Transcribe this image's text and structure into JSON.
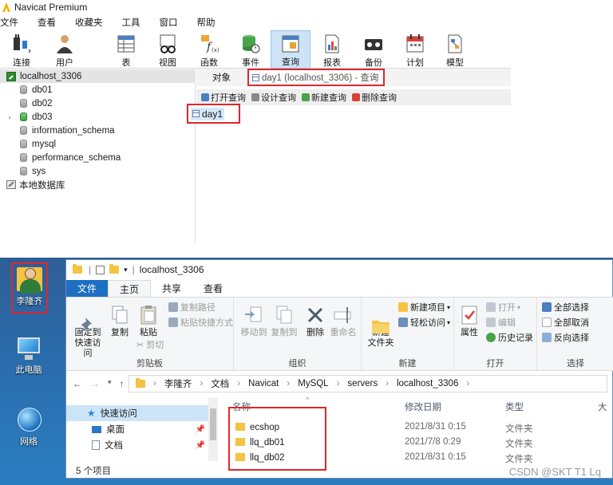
{
  "navicat": {
    "app_title": "Navicat Premium",
    "menu": [
      "文件",
      "查看",
      "收藏夹",
      "工具",
      "窗口",
      "帮助"
    ],
    "toolbar": [
      {
        "label": "连接",
        "icon": "plug-icon"
      },
      {
        "label": "用户",
        "icon": "user-icon"
      },
      {
        "label": "表",
        "icon": "table-icon"
      },
      {
        "label": "视图",
        "icon": "view-icon"
      },
      {
        "label": "函数",
        "icon": "function-icon"
      },
      {
        "label": "事件",
        "icon": "event-icon"
      },
      {
        "label": "查询",
        "icon": "query-icon",
        "active": true
      },
      {
        "label": "报表",
        "icon": "report-icon"
      },
      {
        "label": "备份",
        "icon": "backup-icon"
      },
      {
        "label": "计划",
        "icon": "schedule-icon"
      },
      {
        "label": "模型",
        "icon": "model-icon"
      }
    ],
    "tree": {
      "connection": "localhost_3306",
      "databases": [
        "db01",
        "db02",
        "db03",
        "information_schema",
        "mysql",
        "performance_schema",
        "sys"
      ],
      "local": "本地数据库"
    },
    "objects_tab": "对象",
    "query_tab": "day1 (localhost_3306) - 查询",
    "query_actions": [
      "打开查询",
      "设计查询",
      "新建查询",
      "删除查询"
    ],
    "query_item": "day1"
  },
  "desktop": {
    "icons": [
      {
        "label": "李隆齐"
      },
      {
        "label": "此电脑"
      },
      {
        "label": "网络"
      }
    ]
  },
  "explorer": {
    "title": "localhost_3306",
    "tabs": [
      "文件",
      "主页",
      "共享",
      "查看"
    ],
    "ribbon": {
      "clipboard": {
        "pin": "固定到\n快速访问",
        "copy": "复制",
        "paste": "粘贴",
        "copy_path": "复制路径",
        "paste_shortcut": "粘贴快捷方式",
        "cut": "剪切",
        "group": "剪贴板"
      },
      "organize": {
        "move_to": "移动到",
        "copy_to": "复制到",
        "delete": "删除",
        "rename": "重命名",
        "group": "组织"
      },
      "new": {
        "new_folder": "新建\n文件夹",
        "new_item": "新建项目",
        "easy_access": "轻松访问",
        "group": "新建"
      },
      "open": {
        "properties": "属性",
        "open": "打开",
        "edit": "编辑",
        "history": "历史记录",
        "group": "打开"
      },
      "select": {
        "select_all": "全部选择",
        "select_none": "全部取消",
        "invert": "反向选择",
        "group": "选择"
      }
    },
    "breadcrumb": [
      "李隆齐",
      "文档",
      "Navicat",
      "MySQL",
      "servers",
      "localhost_3306"
    ],
    "nav": [
      {
        "label": "快速访问"
      },
      {
        "label": "桌面"
      },
      {
        "label": "文档"
      }
    ],
    "columns": [
      "名称",
      "修改日期",
      "类型",
      "大"
    ],
    "files": [
      {
        "name": "ecshop",
        "date": "2021/8/31 0:15",
        "type": "文件夹"
      },
      {
        "name": "llq_db01",
        "date": "2021/7/8 0:29",
        "type": "文件夹"
      },
      {
        "name": "llq_db02",
        "date": "2021/8/31 0:15",
        "type": "文件夹"
      }
    ],
    "status": "5 个项目",
    "watermark": "CSDN @SKT T1 Lq"
  }
}
